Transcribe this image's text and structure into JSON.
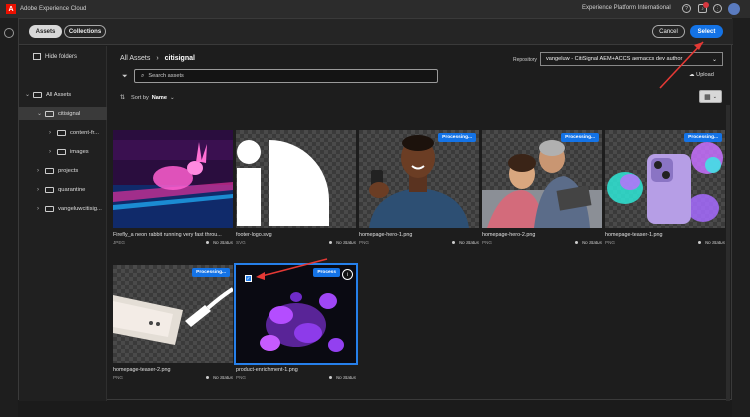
{
  "topbar": {
    "title": "Adobe Experience Cloud",
    "org": "Experience Platform International",
    "help_icon": "help-icon",
    "bell_icon": "bell-icon"
  },
  "modal": {
    "tabs": [
      {
        "label": "Assets"
      },
      {
        "label": "Collections"
      }
    ],
    "cancel_label": "Cancel",
    "select_label": "Select",
    "hide_folders": "Hide folders",
    "breadcrumb": {
      "root": "All Assets",
      "sep": "›",
      "current": "citisignal"
    },
    "repository_label": "Repository",
    "repository_value": "vangeluw - CitiSignal AEM+ACCS aemaccs dev author",
    "upload_label": "Upload",
    "search_placeholder": "Search assets",
    "sort_label": "Sort by",
    "sort_value": "Name"
  },
  "tree": [
    {
      "label": "All Assets",
      "chev": "⌄"
    },
    {
      "label": "citisignal",
      "chev": "⌄"
    },
    {
      "label": "content-fr...",
      "chev": "›"
    },
    {
      "label": "images",
      "chev": "›"
    },
    {
      "label": "projects",
      "chev": "›"
    },
    {
      "label": "quarantine",
      "chev": "›"
    },
    {
      "label": "vangeluwcitisig...",
      "chev": "›"
    }
  ],
  "assets": [
    {
      "name": "Firefly_a neon rabbit running very fast throu...",
      "type": "JPEG",
      "status": "No Status",
      "processing": ""
    },
    {
      "name": "footer-logo.svg",
      "type": "SVG",
      "status": "No Status",
      "processing": ""
    },
    {
      "name": "homepage-hero-1.png",
      "type": "PNG",
      "status": "No Status",
      "processing": "Processing..."
    },
    {
      "name": "homepage-hero-2.png",
      "type": "PNG",
      "status": "No Status",
      "processing": "Processing..."
    },
    {
      "name": "homepage-teaser-1.png",
      "type": "PNG",
      "status": "No Status",
      "processing": "Processing..."
    },
    {
      "name": "homepage-teaser-2.png",
      "type": "PNG",
      "status": "No Status",
      "processing": "Processing..."
    },
    {
      "name": "product-enrichment-1.png",
      "type": "PNG",
      "status": "No Status",
      "processing": "Process"
    }
  ],
  "colors": {
    "accent": "#1473e6",
    "annotation": "#e53935"
  }
}
